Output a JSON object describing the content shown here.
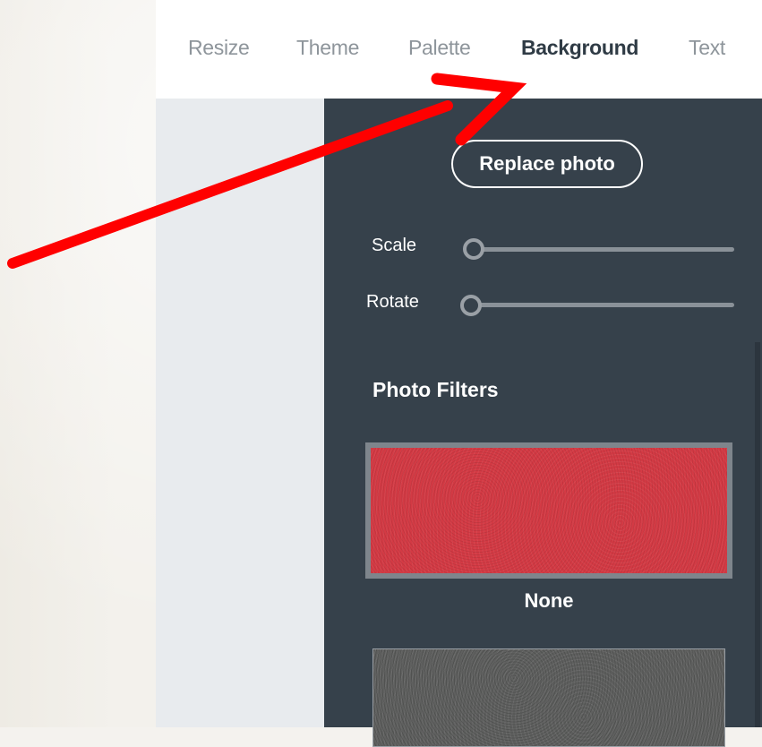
{
  "tabs": [
    {
      "label": "Resize",
      "active": false
    },
    {
      "label": "Theme",
      "active": false
    },
    {
      "label": "Palette",
      "active": false
    },
    {
      "label": "Background",
      "active": true
    },
    {
      "label": "Text",
      "active": false
    }
  ],
  "panel": {
    "replace_button": "Replace photo",
    "sliders": [
      {
        "label": "Scale",
        "value": 0
      },
      {
        "label": "Rotate",
        "value": 0
      }
    ],
    "section_title": "Photo Filters",
    "filters": [
      {
        "label": "None",
        "selected": true,
        "color": "#d33a44"
      },
      {
        "label": "",
        "selected": false,
        "color": "#5f605f"
      }
    ]
  },
  "annotation": {
    "arrow_color": "#ff0000",
    "points_to": "Background tab"
  },
  "colors": {
    "panel_bg": "#36414b",
    "active_tab": "#2f3b45",
    "inactive_tab": "#8e959b"
  }
}
